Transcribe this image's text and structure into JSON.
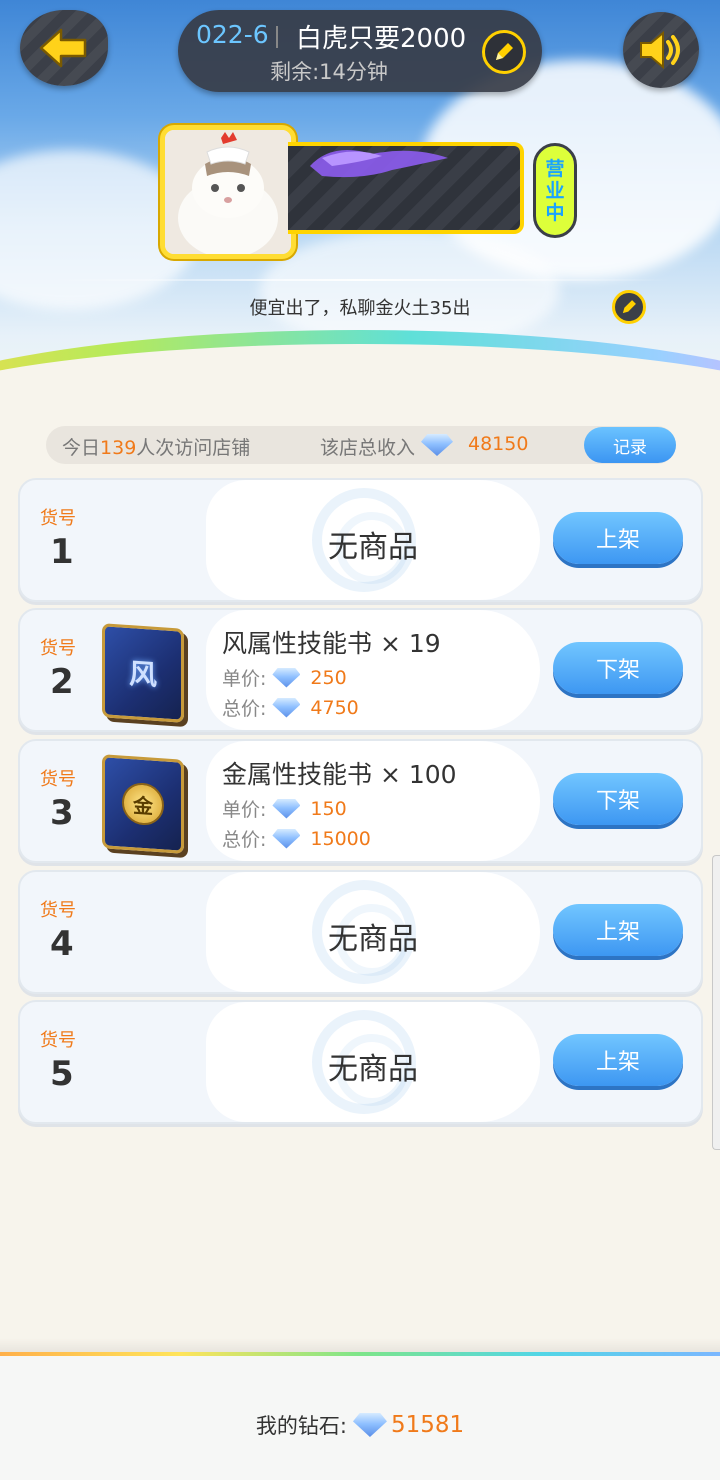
{
  "header": {
    "shop_code": "022-6",
    "shop_name": "白虎只要2000",
    "remaining_label": "剩余:",
    "remaining_value": "14分钟",
    "status_badge": [
      "营",
      "业",
      "中"
    ],
    "announcement": "便宜出了，私聊金火土35出"
  },
  "stats": {
    "visits_prefix": "今日",
    "visits_count": "139",
    "visits_suffix": "人次访问店铺",
    "income_label": "该店总收入",
    "income_value": "48150",
    "record_button": "记录"
  },
  "slot_label": "货号",
  "price_labels": {
    "unit": "单价:",
    "total": "总价:"
  },
  "slots": [
    {
      "number": "1",
      "empty_text": "无商品",
      "button": "上架"
    },
    {
      "number": "2",
      "item_name": "风属性技能书 × 19",
      "icon_glyph": "风",
      "unit_price": "250",
      "total_price": "4750",
      "button": "下架"
    },
    {
      "number": "3",
      "item_name": "金属性技能书 × 100",
      "icon_glyph": "金",
      "unit_price": "150",
      "total_price": "15000",
      "button": "下架"
    },
    {
      "number": "4",
      "empty_text": "无商品",
      "button": "上架"
    },
    {
      "number": "5",
      "empty_text": "无商品",
      "button": "上架"
    }
  ],
  "footer": {
    "my_diamond_label": "我的钻石:",
    "my_diamond_value": "51581"
  },
  "icons": {
    "back": "arrow-left-icon",
    "sound": "speaker-icon",
    "edit": "pencil-icon",
    "currency": "diamond-icon"
  },
  "colors": {
    "accent_orange": "#f07a1a",
    "button_blue": "#3d97f2",
    "badge_yellow": "#ddff3a",
    "frame_gold": "#ffdd33"
  }
}
